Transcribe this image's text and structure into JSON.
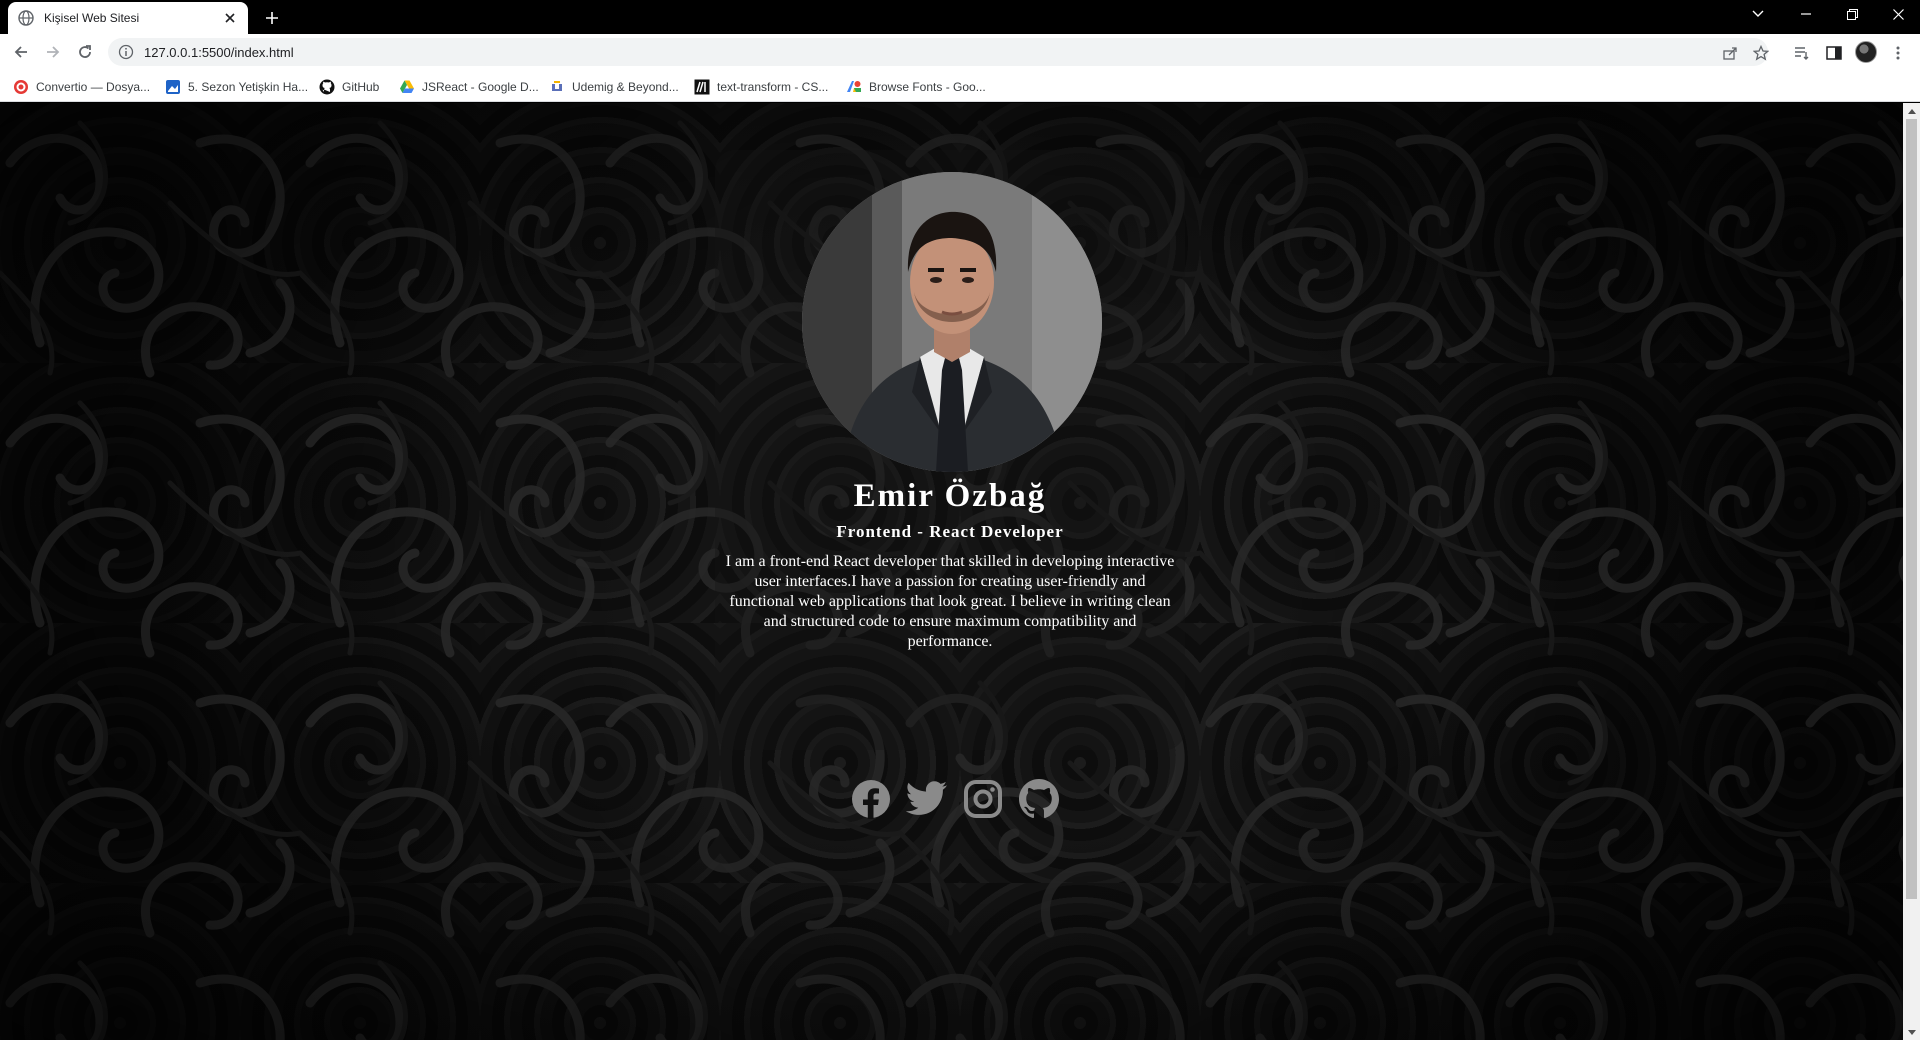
{
  "browser": {
    "tab_title": "Kişisel Web Sitesi",
    "url": "127.0.0.1:5500/index.html",
    "bookmarks": [
      {
        "label": "Convertio — Dosya...",
        "color": "#e53935"
      },
      {
        "label": "5. Sezon Yetişkin Ha...",
        "color": "#1e63c7"
      },
      {
        "label": "GitHub",
        "color": "#111111"
      },
      {
        "label": "JSReact - Google D...",
        "color": "#34a853"
      },
      {
        "label": "Udemig & Beyond...",
        "color": "#5a6fb8"
      },
      {
        "label": "text-transform - CS...",
        "color": "#111111"
      },
      {
        "label": "Browse Fonts - Goo...",
        "color": "#4285f4"
      }
    ]
  },
  "profile": {
    "name": "Emir Özbağ",
    "role": "Frontend - React Developer",
    "bio": "I am a front-end React developer that skilled in developing interactive user interfaces.I have a passion for creating user-friendly and functional web applications that look great. I believe in writing clean and structured code to ensure maximum compatibility and performance."
  },
  "socials": [
    {
      "icon": "facebook-icon"
    },
    {
      "icon": "twitter-icon"
    },
    {
      "icon": "instagram-icon"
    },
    {
      "icon": "github-icon"
    }
  ],
  "colors": {
    "background": "#0b0b0b",
    "text": "#ffffff",
    "social_icon": "#8a8a8a"
  }
}
